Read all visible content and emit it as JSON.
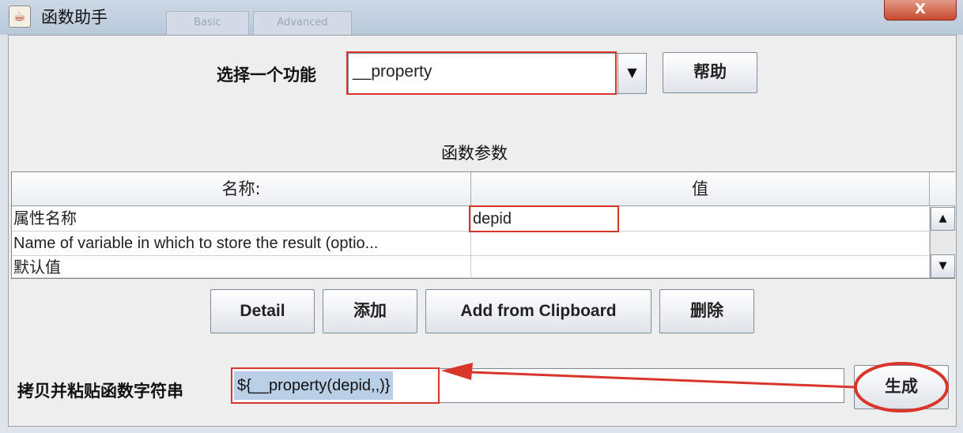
{
  "window": {
    "title": "函数助手",
    "app_icon": "java-cup-icon",
    "close_label": "X",
    "background_tabs": [
      "Basic",
      "Advanced"
    ]
  },
  "function_select": {
    "label": "选择一个功能",
    "value": "__property",
    "help_button": "帮助"
  },
  "params": {
    "section_title": "函数参数",
    "columns": [
      "名称:",
      "值"
    ],
    "rows": [
      {
        "name": "属性名称",
        "value": "depid"
      },
      {
        "name": "Name of variable in which to store the result (optio...",
        "value": ""
      },
      {
        "name": "默认值",
        "value": ""
      }
    ]
  },
  "buttons": {
    "detail": "Detail",
    "add": "添加",
    "add_clipboard": "Add from Clipboard",
    "delete": "删除"
  },
  "result": {
    "label": "拷贝并粘贴函数字符串",
    "value": "${__property(depid,,)}",
    "generate_button": "生成"
  },
  "colors": {
    "annotation_red": "#d9352b",
    "selection_blue": "#b8cfe5"
  }
}
